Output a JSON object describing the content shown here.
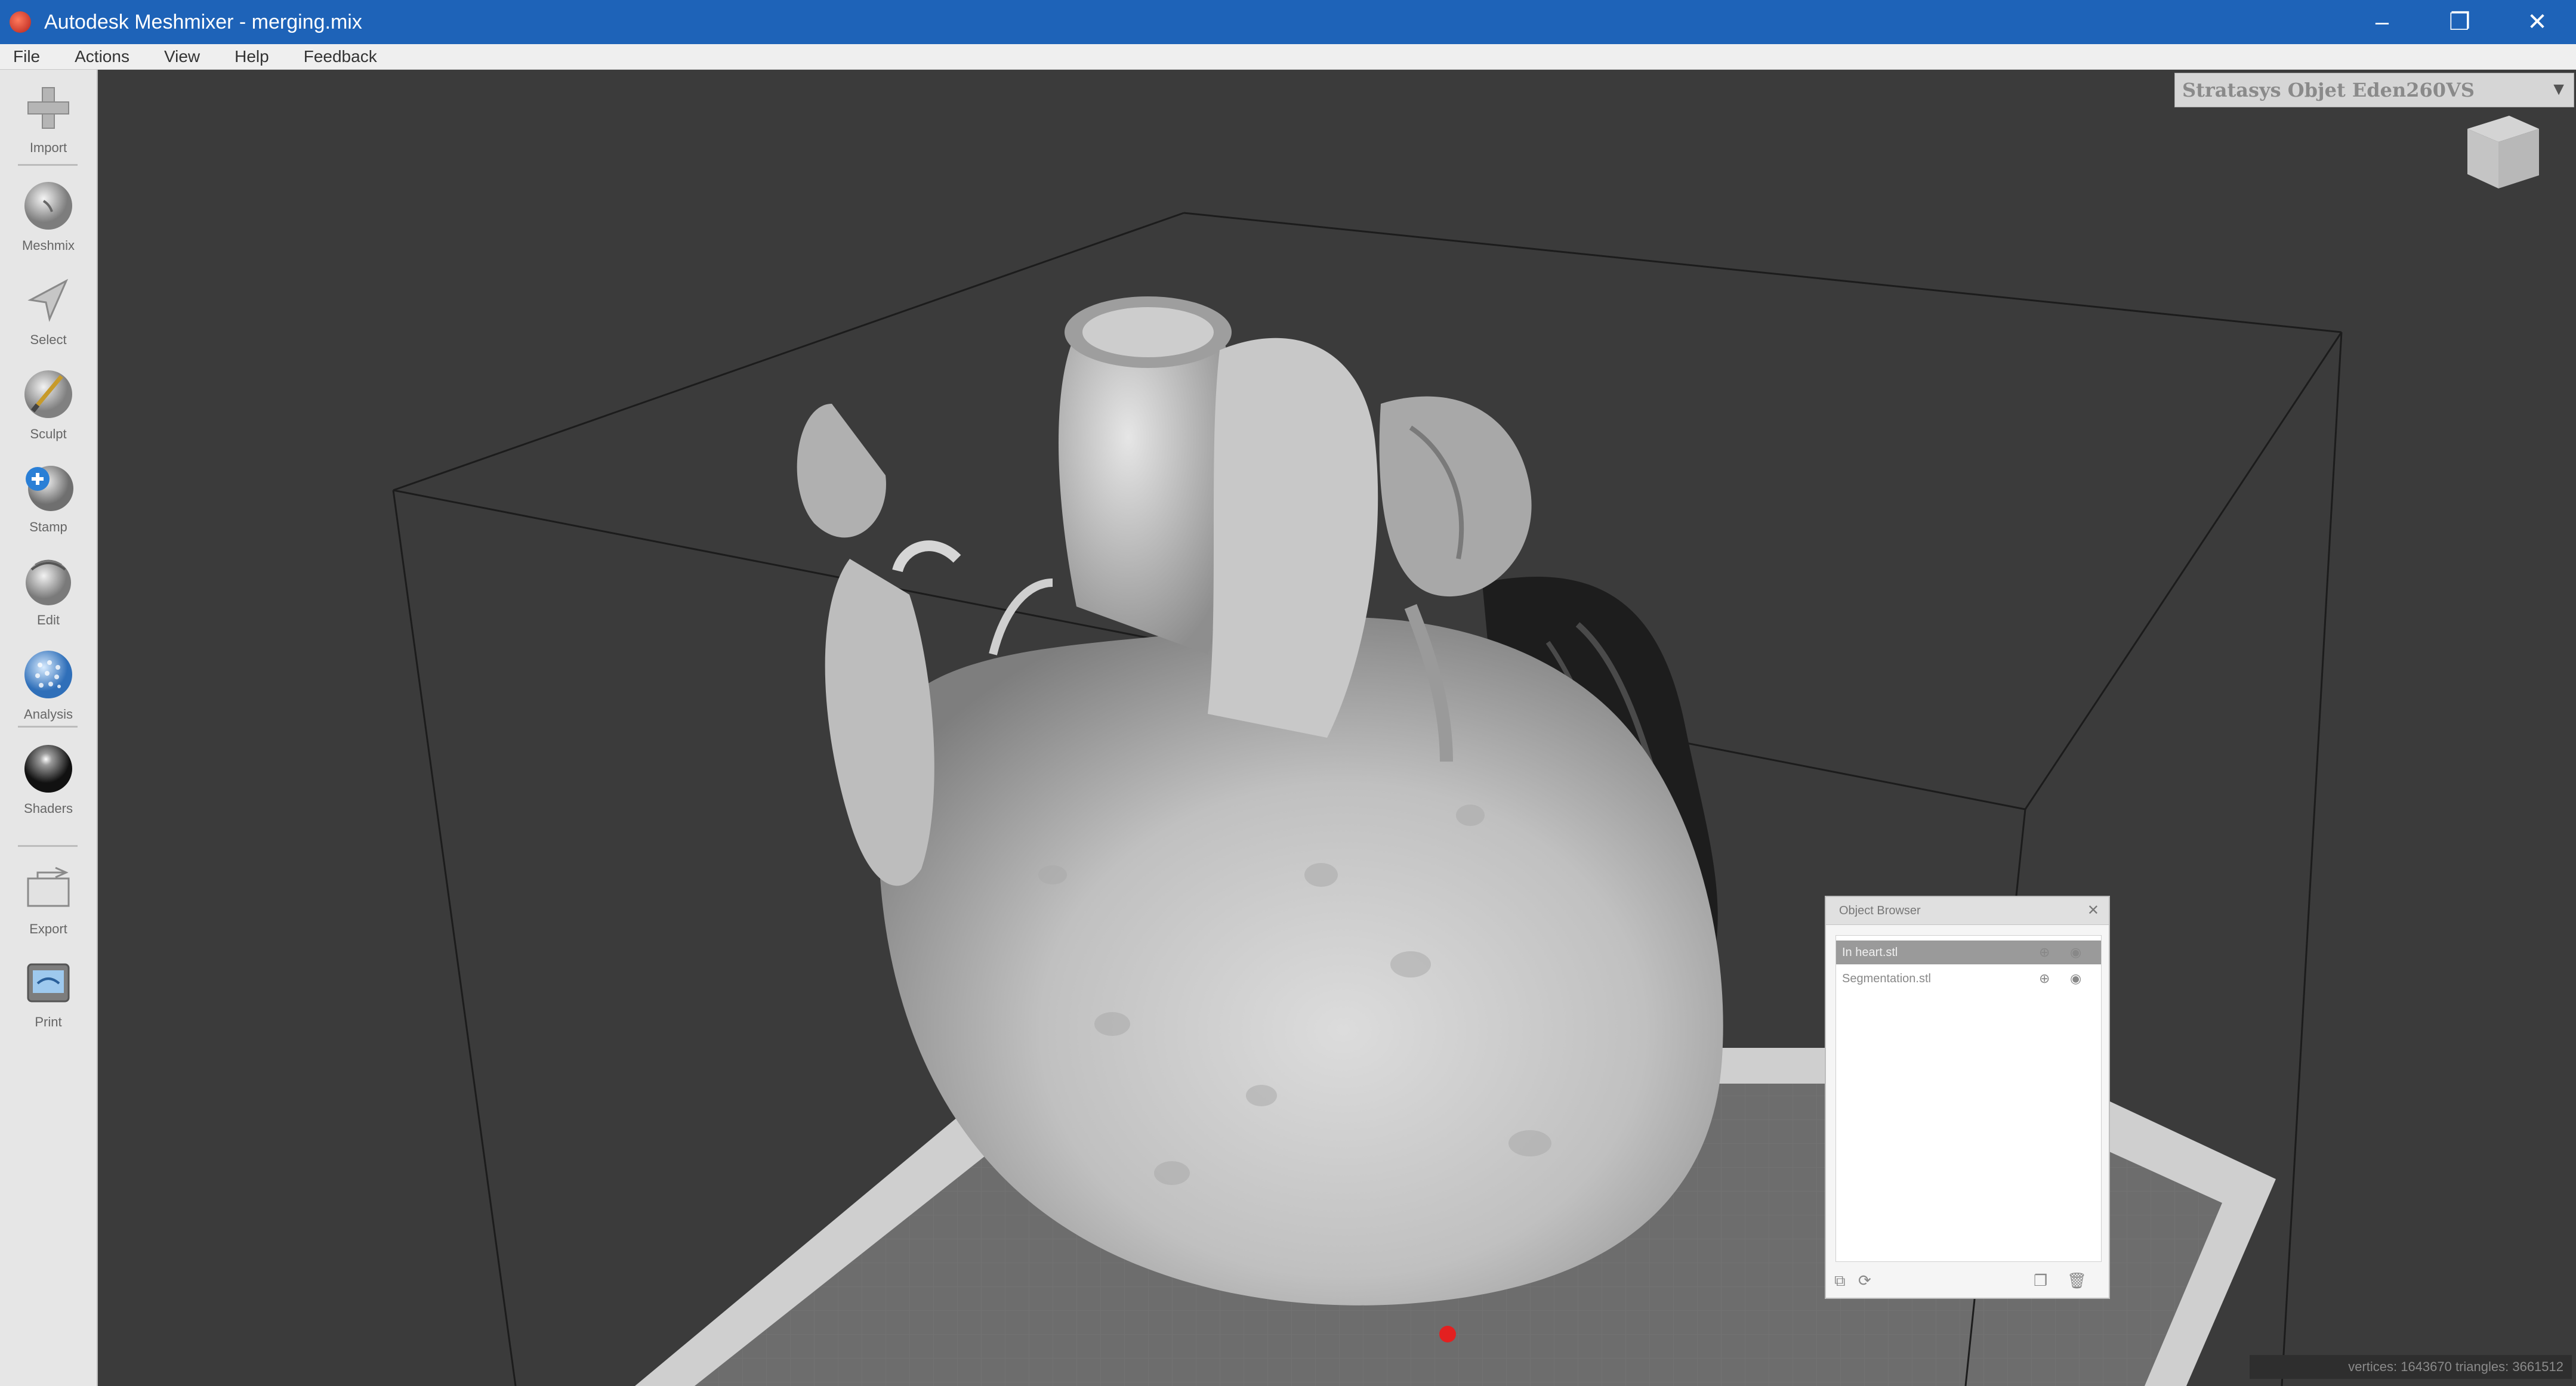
{
  "window": {
    "title": "Autodesk Meshmixer - merging.mix",
    "controls": [
      "–",
      "❐",
      "✕"
    ]
  },
  "menu": [
    "File",
    "Actions",
    "View",
    "Help",
    "Feedback"
  ],
  "toolbar": [
    {
      "label": "Import",
      "icon": "plus-icon"
    },
    {
      "label": "Meshmix",
      "icon": "meshmix-sphere-icon"
    },
    {
      "label": "Select",
      "icon": "select-arrow-icon"
    },
    {
      "label": "Sculpt",
      "icon": "sculpt-brush-icon"
    },
    {
      "label": "Stamp",
      "icon": "stamp-icon"
    },
    {
      "label": "Edit",
      "icon": "edit-sphere-icon"
    },
    {
      "label": "Analysis",
      "icon": "analysis-sphere-icon"
    },
    {
      "label": "Shaders",
      "icon": "shaders-sphere-icon"
    },
    {
      "label": "Export",
      "icon": "export-icon"
    },
    {
      "label": "Print",
      "icon": "print-icon"
    }
  ],
  "printer": {
    "selected": "Stratasys Objet Eden260VS"
  },
  "object_browser": {
    "title": "Object Browser",
    "items": [
      {
        "name": "In heart.stl",
        "selected": true
      },
      {
        "name": "Segmentation.stl",
        "selected": false
      }
    ]
  },
  "status": "vertices: 1643670 triangles: 3661512",
  "colors": {
    "titlebar": "#1e63b8",
    "viewport_bg": "#3b3b3b",
    "print_bed": "#6a6a6a",
    "model": "#c9c9c9"
  }
}
